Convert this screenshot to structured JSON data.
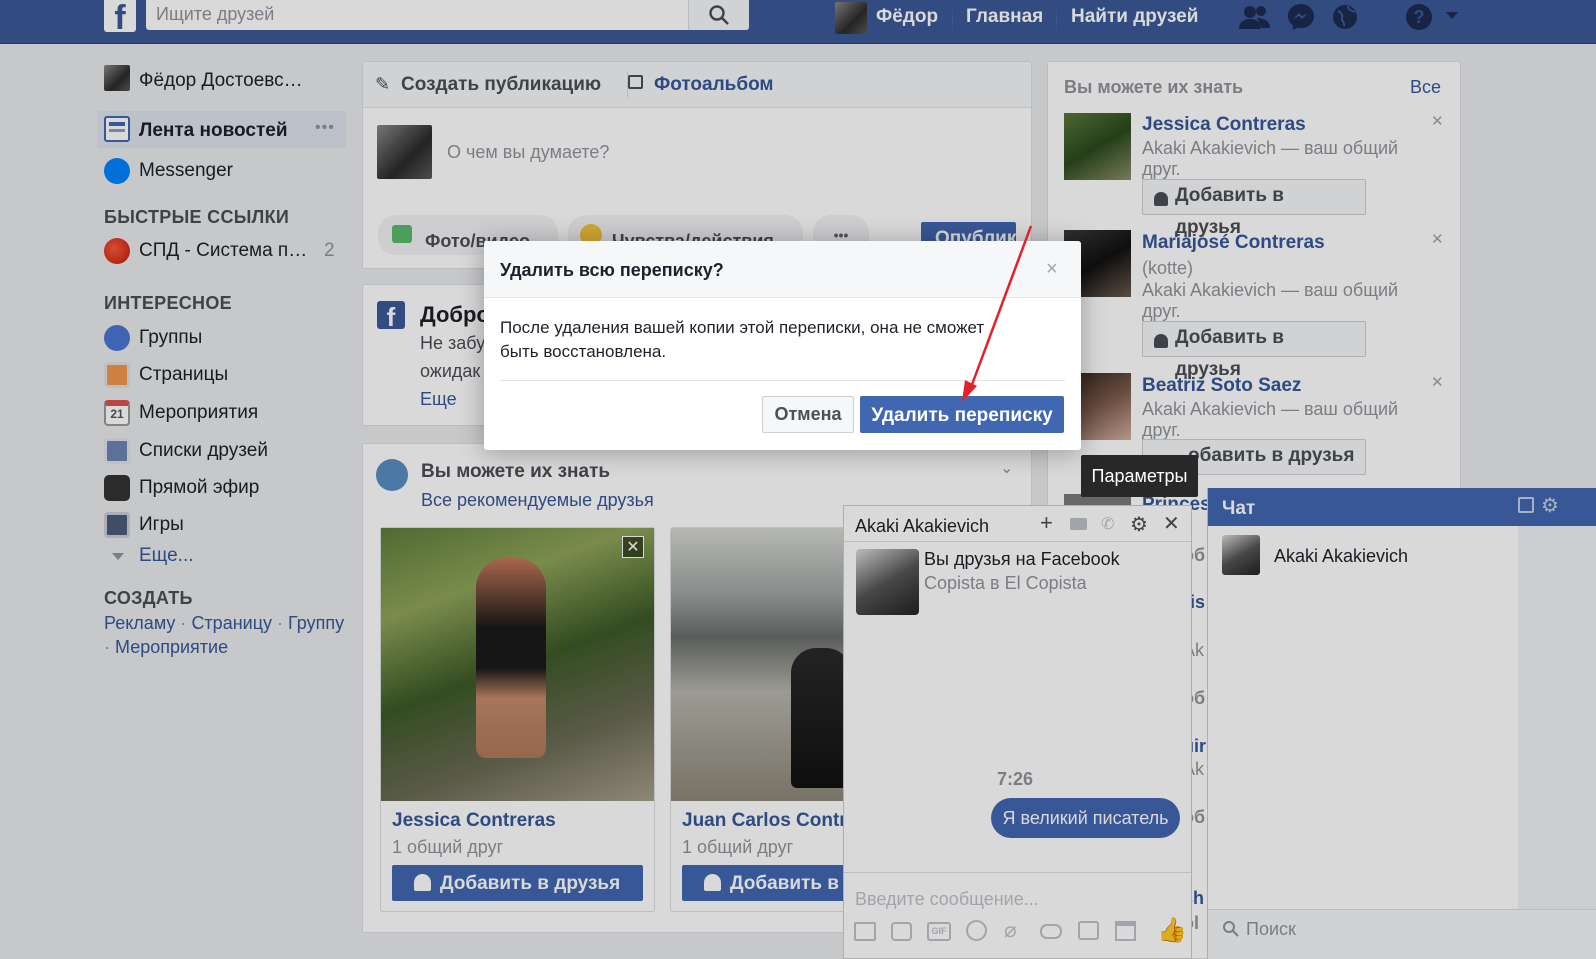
{
  "topbar": {
    "logo": "f",
    "search_placeholder": "Ищите друзей",
    "user_name": "Фёдор",
    "home": "Главная",
    "find_friends": "Найти друзей",
    "icons": [
      "friends-icon",
      "messenger-icon",
      "globe-icon",
      "help-icon",
      "dropdown-icon"
    ]
  },
  "sidebar": {
    "profile_name": "Фёдор Достоевс…",
    "items": [
      {
        "label": "Лента новостей",
        "more": "•••"
      },
      {
        "label": "Messenger"
      }
    ],
    "quick_links_title": "БЫСТРЫЕ ССЫЛКИ",
    "quick_link": {
      "label": "СПД - Система п…",
      "count": "2"
    },
    "interesting_title": "ИНТЕРЕСНОЕ",
    "interesting": [
      "Группы",
      "Страницы",
      "Мероприятия",
      "Списки друзей",
      "Прямой эфир",
      "Игры"
    ],
    "calendar_day": "21",
    "more": "Еще...",
    "create_title": "СОЗДАТЬ",
    "create_links": [
      "Рекламу",
      "Страницу",
      "Группу",
      "Мероприятие"
    ],
    "dot": "·"
  },
  "composer": {
    "create_post": "Создать публикацию",
    "photo_album": "Фотоальбом",
    "placeholder": "О чем вы думаете?",
    "photo_video": "Фото/видео",
    "feelings": "Чувства/действия",
    "more": "•••",
    "publish": "Опублик"
  },
  "welcome": {
    "title": "Добро",
    "line1": "Не забу",
    "line2": "ожидак",
    "more": "Еще"
  },
  "pymk": {
    "title": "Вы можете их знать",
    "all_link": "Все рекомендуемые друзья",
    "cards": [
      {
        "name": "Jessica Contreras",
        "mutual": "1 общий друг",
        "button": "Добавить в друзья"
      },
      {
        "name": "Juan Carlos Contr",
        "mutual": "1 общий друг",
        "button": "Добавить в"
      }
    ]
  },
  "right_col": {
    "title": "Вы можете их знать",
    "all": "Все",
    "people": [
      {
        "name": "Jessica Contreras",
        "extra": "",
        "mutual": "Akaki Akakievich — ваш общий",
        "mutual2": "друг.",
        "button": "Добавить в друзья"
      },
      {
        "name": "Mariajosé Contreras",
        "extra": "(kotte)",
        "mutual": "Akaki Akakievich — ваш общий",
        "mutual2": "друг.",
        "button": "Добавить в друзья"
      },
      {
        "name": "Beatriz Soto Saez",
        "extra": "",
        "mutual": "Akaki Akakievich — ваш общий",
        "mutual2": "друг.",
        "button": "обавить в друзья"
      }
    ],
    "partial_name": "Princes",
    "partial_rows": [
      "я",
      "об",
      "ris",
      "Ak",
      "об",
      "uir",
      "Ak",
      "об",
      "sh",
      "ol"
    ]
  },
  "tooltip": "Параметры",
  "modal": {
    "title": "Удалить всю переписку?",
    "body_line1": "После удаления вашей копии этой переписки, она не сможет",
    "body_line2": "быть восстановлена.",
    "cancel": "Отмена",
    "confirm": "Удалить переписку",
    "close": "×"
  },
  "chat_window": {
    "name": "Akaki Akakievich",
    "friends_text": "Вы друзья на Facebook",
    "work_text": "Copista в El Copista",
    "time": "7:26",
    "message": "Я великий писатель",
    "input_placeholder": "Введите сообщение...",
    "gif": "GIF"
  },
  "chat_sidebar": {
    "title": "Чат",
    "contact": "Akaki Akakievich",
    "search_placeholder": "Поиск"
  },
  "colors": {
    "brand": "#3b5998",
    "primary_button": "#4267b2",
    "link": "#365899",
    "annotation_arrow": "#e0222a"
  }
}
